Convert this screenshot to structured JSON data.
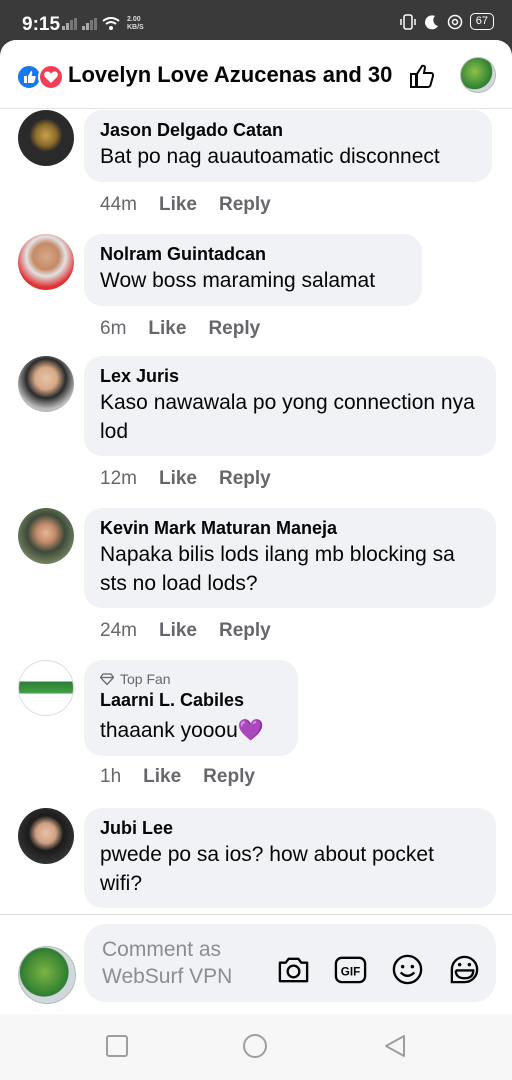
{
  "status_bar": {
    "time": "9:15",
    "speed_line1": "2.00",
    "speed_line2": "KB/S",
    "battery": "67"
  },
  "header": {
    "title": "Lovelyn Love Azucenas and 30 ..."
  },
  "comments": [
    {
      "author": "Jason Delgado Catan",
      "text": "Bat po nag auautoamatic disconnect",
      "time": "44m",
      "like": "Like",
      "reply": "Reply"
    },
    {
      "author": "Nolram Guintadcan",
      "text": "Wow boss maraming salamat",
      "time": "6m",
      "like": "Like",
      "reply": "Reply"
    },
    {
      "author": "Lex Juris",
      "text": "Kaso nawawala po yong connection nya lod",
      "time": "12m",
      "like": "Like",
      "reply": "Reply"
    },
    {
      "author": "Kevin Mark Maturan Maneja",
      "text": "Napaka bilis lods ilang mb blocking sa sts no load lods?",
      "time": "24m",
      "like": "Like",
      "reply": "Reply"
    },
    {
      "badge": "Top Fan",
      "author": "Laarni L. Cabiles",
      "text": "thaaank yooou💜",
      "time": "1h",
      "like": "Like",
      "reply": "Reply"
    },
    {
      "author": "Jubi Lee",
      "text": "pwede po sa ios? how about pocket wifi?"
    }
  ],
  "composer": {
    "placeholder": "Comment as WebSurf VPN",
    "icons": [
      "camera-icon",
      "gif-icon",
      "emoji-icon",
      "sticker-icon"
    ]
  },
  "nav": {
    "icons": [
      "recents-square-icon",
      "home-circle-icon",
      "back-triangle-icon"
    ]
  },
  "colors": {
    "like_blue": "#1877f2",
    "love_red": "#f33e58",
    "bubble_gray": "#f0f2f5",
    "meta_gray": "#65676b"
  }
}
